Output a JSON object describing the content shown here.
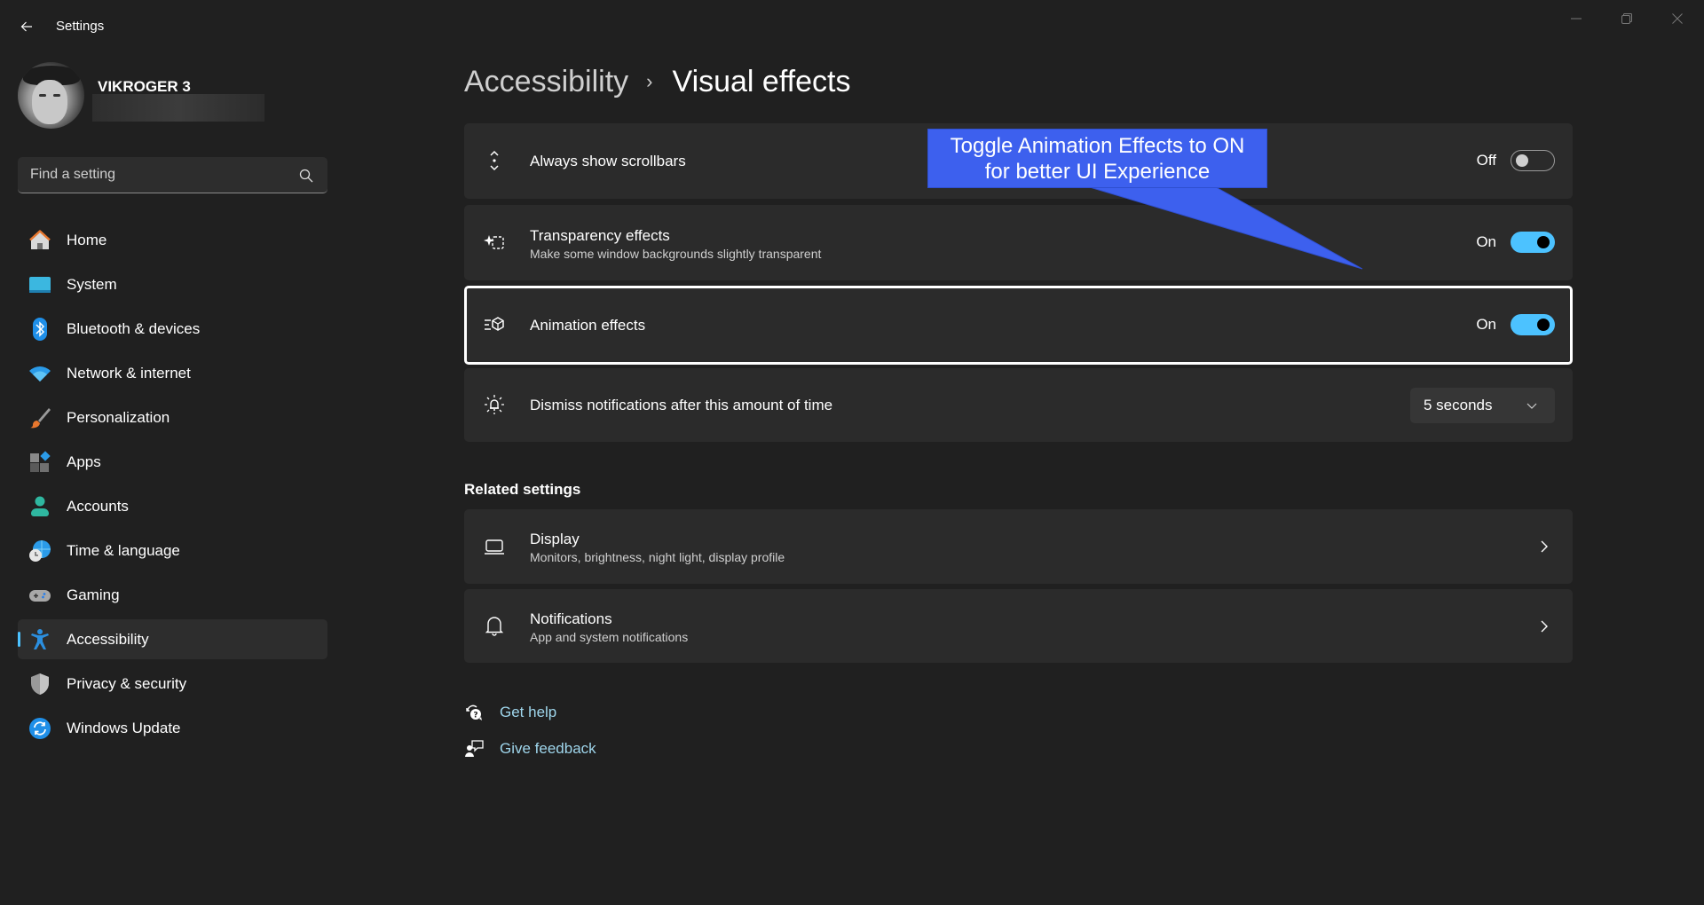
{
  "window": {
    "title": "Settings",
    "back_icon": "arrow-left",
    "controls": [
      "minimize",
      "restore",
      "close"
    ]
  },
  "profile": {
    "name": "VIKROGER 3",
    "email_redacted": true
  },
  "search": {
    "placeholder": "Find a setting",
    "value": "",
    "icon": "search"
  },
  "sidebar": {
    "items": [
      {
        "label": "Home",
        "icon": "home",
        "active": false
      },
      {
        "label": "System",
        "icon": "system-monitor",
        "active": false
      },
      {
        "label": "Bluetooth & devices",
        "icon": "bluetooth",
        "active": false
      },
      {
        "label": "Network & internet",
        "icon": "wifi",
        "active": false
      },
      {
        "label": "Personalization",
        "icon": "paintbrush",
        "active": false
      },
      {
        "label": "Apps",
        "icon": "apps",
        "active": false
      },
      {
        "label": "Accounts",
        "icon": "person",
        "active": false
      },
      {
        "label": "Time & language",
        "icon": "globe-clock",
        "active": false
      },
      {
        "label": "Gaming",
        "icon": "gamepad",
        "active": false
      },
      {
        "label": "Accessibility",
        "icon": "accessibility",
        "active": true
      },
      {
        "label": "Privacy & security",
        "icon": "shield",
        "active": false
      },
      {
        "label": "Windows Update",
        "icon": "sync",
        "active": false
      }
    ]
  },
  "breadcrumb": {
    "parent": "Accessibility",
    "separator": "›",
    "current": "Visual effects"
  },
  "settings": [
    {
      "title": "Always show scrollbars",
      "subtitle": "",
      "icon": "scrollbar",
      "control": "toggle",
      "state_label": "Off",
      "on": false
    },
    {
      "title": "Transparency effects",
      "subtitle": "Make some window backgrounds slightly transparent",
      "icon": "transparency",
      "control": "toggle",
      "state_label": "On",
      "on": true
    },
    {
      "title": "Animation effects",
      "subtitle": "",
      "icon": "animation",
      "control": "toggle",
      "state_label": "On",
      "on": true,
      "highlighted": true
    },
    {
      "title": "Dismiss notifications after this amount of time",
      "subtitle": "",
      "icon": "notification-timer",
      "control": "dropdown",
      "value": "5 seconds"
    }
  ],
  "related": {
    "heading": "Related settings",
    "items": [
      {
        "title": "Display",
        "subtitle": "Monitors, brightness, night light, display profile",
        "icon": "laptop"
      },
      {
        "title": "Notifications",
        "subtitle": "App and system notifications",
        "icon": "bell"
      }
    ]
  },
  "help_links": [
    {
      "label": "Get help",
      "icon": "help-chat"
    },
    {
      "label": "Give feedback",
      "icon": "feedback"
    }
  ],
  "annotation": {
    "text": "Toggle Animation Effects to ON\nfor better UI Experience",
    "color": "#3d60ee"
  },
  "colors": {
    "background": "#202020",
    "card": "#2b2b2b",
    "accent": "#4cc2ff",
    "link": "#9fd6ec"
  }
}
